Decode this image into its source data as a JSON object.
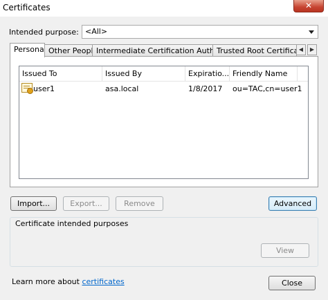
{
  "window": {
    "title": "Certificates",
    "close_symbol": "✕"
  },
  "purpose": {
    "label": "Intended purpose:",
    "selected": "<All>"
  },
  "tabs": [
    {
      "label": "Personal",
      "active": true
    },
    {
      "label": "Other People",
      "active": false
    },
    {
      "label": "Intermediate Certification Authorities",
      "active": false
    },
    {
      "label": "Trusted Root Certification Authorities",
      "active": false
    }
  ],
  "tab_scroll": {
    "left": "◀",
    "right": "▶"
  },
  "list": {
    "columns": [
      "Issued To",
      "Issued By",
      "Expiratio...",
      "Friendly Name"
    ],
    "rows": [
      {
        "icon": "certificate-icon",
        "issued_to": "user1",
        "issued_by": "asa.local",
        "expiration": "1/8/2017",
        "friendly_name": "ou=TAC,cn=user1"
      }
    ]
  },
  "buttons": {
    "import": "Import...",
    "export": "Export...",
    "remove": "Remove",
    "advanced": "Advanced",
    "view": "View",
    "close": "Close"
  },
  "purposes_group": {
    "title": "Certificate intended purposes"
  },
  "footer": {
    "learn_more_prefix": "Learn more about",
    "learn_more_link": "certificates"
  },
  "colors": {
    "link": "#0066cc",
    "close_button": "#c74532",
    "default_button_border": "#3c7fb1"
  }
}
